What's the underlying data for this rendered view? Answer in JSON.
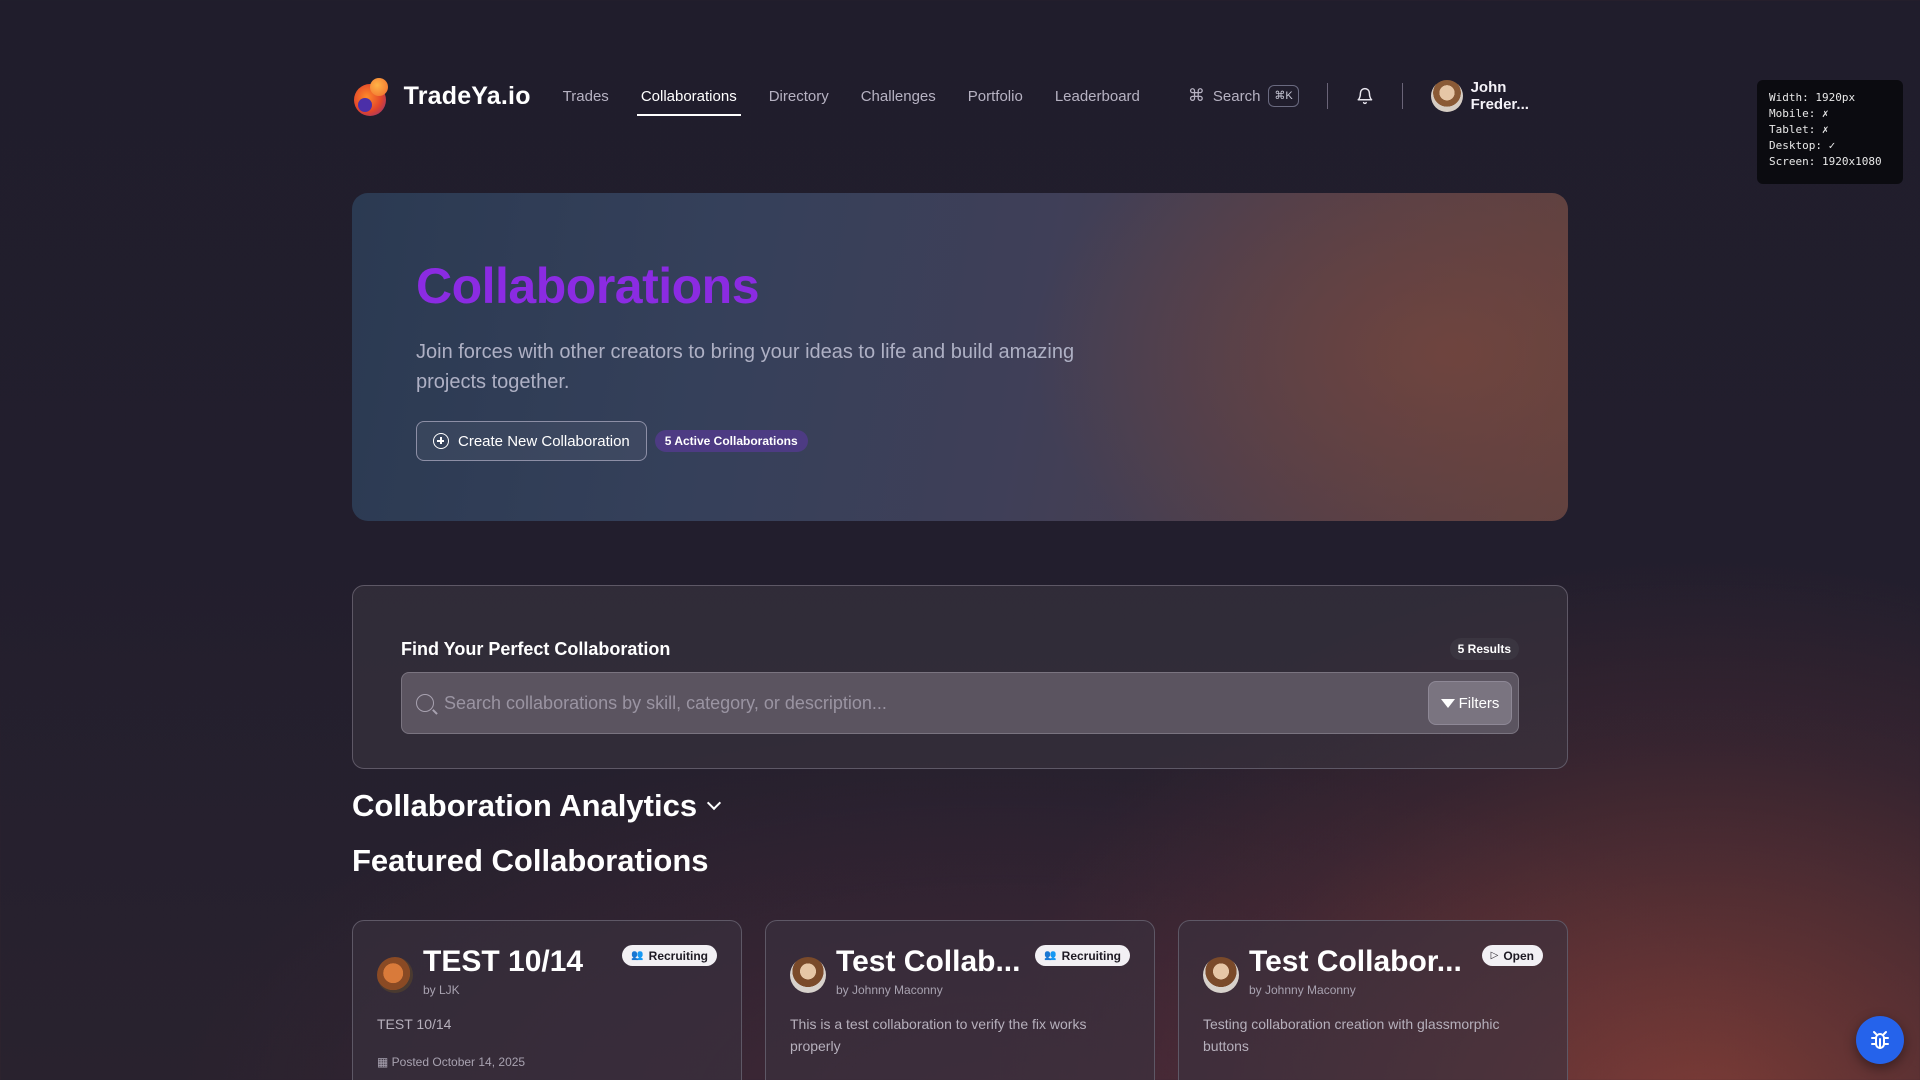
{
  "nav": {
    "brand": "TradeYa.io",
    "links": [
      {
        "label": "Trades"
      },
      {
        "label": "Collaborations"
      },
      {
        "label": "Directory"
      },
      {
        "label": "Challenges"
      },
      {
        "label": "Portfolio"
      },
      {
        "label": "Leaderboard"
      }
    ],
    "active_link": "Collaborations",
    "search_label": "Search",
    "search_shortcut": "⌘K",
    "user_name": "John Freder..."
  },
  "debug": {
    "width": "Width: 1920px",
    "mobile": "Mobile: ✗",
    "tablet": "Tablet: ✗",
    "desktop": "Desktop: ✓",
    "screen": "Screen: 1920x1080"
  },
  "hero": {
    "title": "Collaborations",
    "subtitle": "Join forces with other creators to bring your ideas to life and build amazing projects together.",
    "create_button": "Create New Collaboration",
    "active_badge": "5 Active Collaborations"
  },
  "search": {
    "title": "Find Your Perfect Collaboration",
    "results": "5 Results",
    "placeholder": "Search collaborations by skill, category, or description...",
    "filters_label": "Filters"
  },
  "analytics_title": "Collaboration Analytics",
  "featured_title": "Featured Collaborations",
  "cards": [
    {
      "title": "TEST 10/14",
      "by": "by LJK",
      "badge": "Recruiting",
      "badge_icon": "users-icon",
      "description": "TEST 10/14",
      "posted": "Posted October 14, 2025"
    },
    {
      "title": "Test Collab...",
      "by": "by Johnny Maconny",
      "badge": "Recruiting",
      "badge_icon": "users-icon",
      "description": "This is a test collaboration to verify the fix works properly",
      "posted": ""
    },
    {
      "title": "Test Collabor...",
      "by": "by Johnny Maconny",
      "badge": "Open",
      "badge_icon": "play-icon",
      "description": "Testing collaboration creation with glassmorphic buttons",
      "posted": ""
    }
  ],
  "colors": {
    "accent_purple": "#8b2be2",
    "fab_blue": "#2563eb"
  }
}
